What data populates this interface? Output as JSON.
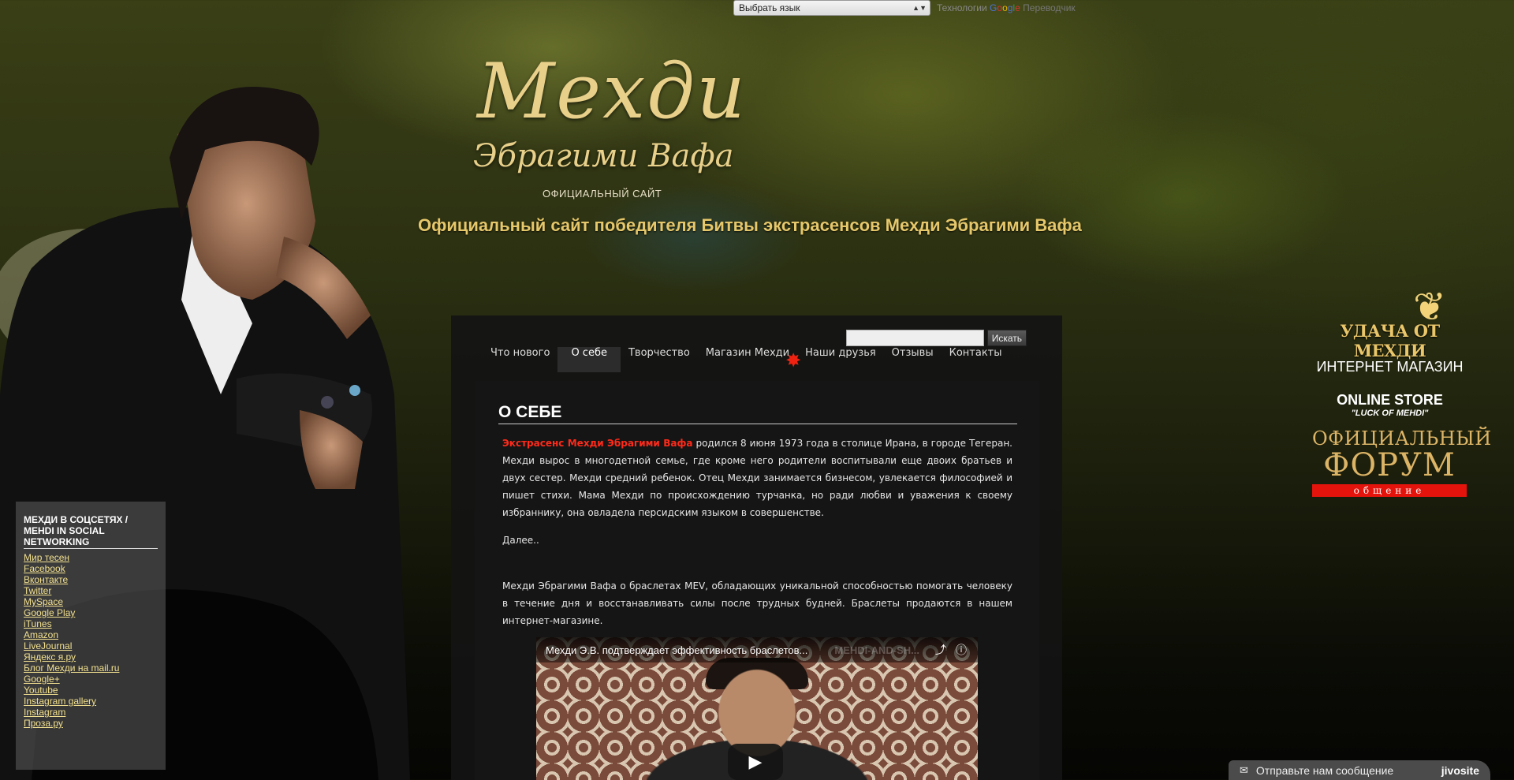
{
  "translate": {
    "select_value": "Выбрать язык",
    "powered_prefix": "Технологии",
    "powered_google": "Google",
    "powered_suffix": "Переводчик"
  },
  "logo": {
    "line1": "Мехди",
    "line2": "Эбрагими Вафа",
    "sub": "ОФИЦИАЛЬНЫЙ САЙТ"
  },
  "tagline": "Официальный сайт победителя Битвы экстрасенсов Мехди Эбрагими Вафа",
  "search": {
    "button": "Искать",
    "value": ""
  },
  "nav": {
    "items": [
      "Что нового",
      "О себе",
      "Творчество",
      "Магазин Мехди",
      "Наши друзья",
      "Отзывы",
      "Контакты"
    ],
    "active": "О себе"
  },
  "content": {
    "title": "О СЕБЕ",
    "p1_highlight": "Экстрасенс Мехди Эбрагими Вафа",
    "p1_rest": " родился 8 июня 1973 года в столице Ирана, в городе Тегеран. Мехди вырос в многодетной семье, где кроме него родители воспитывали еще двоих братьев и двух сестер. Мехди средний ребенок. Отец Мехди занимается бизнесом, увлекается философией и пишет стихи. Мама Мехди по происхождению турчанка, но ради любви и уважения к своему избраннику, она овладела персидским языком в совершенстве.",
    "more": "Далее..",
    "p2": "Мехди Эбрагими Вафа о браслетах MEV, обладающих уникальной способностью помогать человеку в течение дня и восстанавливать силы после трудных будней. Браслеты продаются в нашем интернет-магазине."
  },
  "video": {
    "title": "Мехди Э.В. подтверждает эффективность браслетов...",
    "brand_watermark": "MEHDI-AND-SH...",
    "share_icon": "share-icon",
    "info_icon": "info-icon"
  },
  "social": {
    "heading": "МЕХДИ В СОЦСЕТЯХ / MEHDI IN SOCIAL NETWORKING",
    "links": [
      "Мир тесен",
      "Facebook",
      "Вконтакте",
      "Twitter",
      "MySpace",
      "Google Play",
      "iTunes",
      "Amazon",
      "LiveJournal",
      "Яндекс я.ру",
      "Блог Мехди на mail.ru",
      "Google+",
      "Youtube",
      "Instagram gallery",
      "Instagram",
      "Проза.ру"
    ]
  },
  "store": {
    "luck": "УДАЧА ОТ МЕХДИ",
    "shop": "ИНТЕРНЕТ МАГАЗИН",
    "online": "ONLINE STORE",
    "luck_en": "\"LUCK OF MEHDI\""
  },
  "forum": {
    "line1": "ОФИЦИАЛЬНЫЙ",
    "line2": "ФОРУМ",
    "line3": "общение"
  },
  "jivo": {
    "label": "Отправьте нам сообщение",
    "brand": "jivosite"
  },
  "colors": {
    "accent_gold": "#e6c76a",
    "highlight_red": "#ff2a1a",
    "link_yellow": "#f2e090",
    "forum_red": "#e4140c"
  }
}
